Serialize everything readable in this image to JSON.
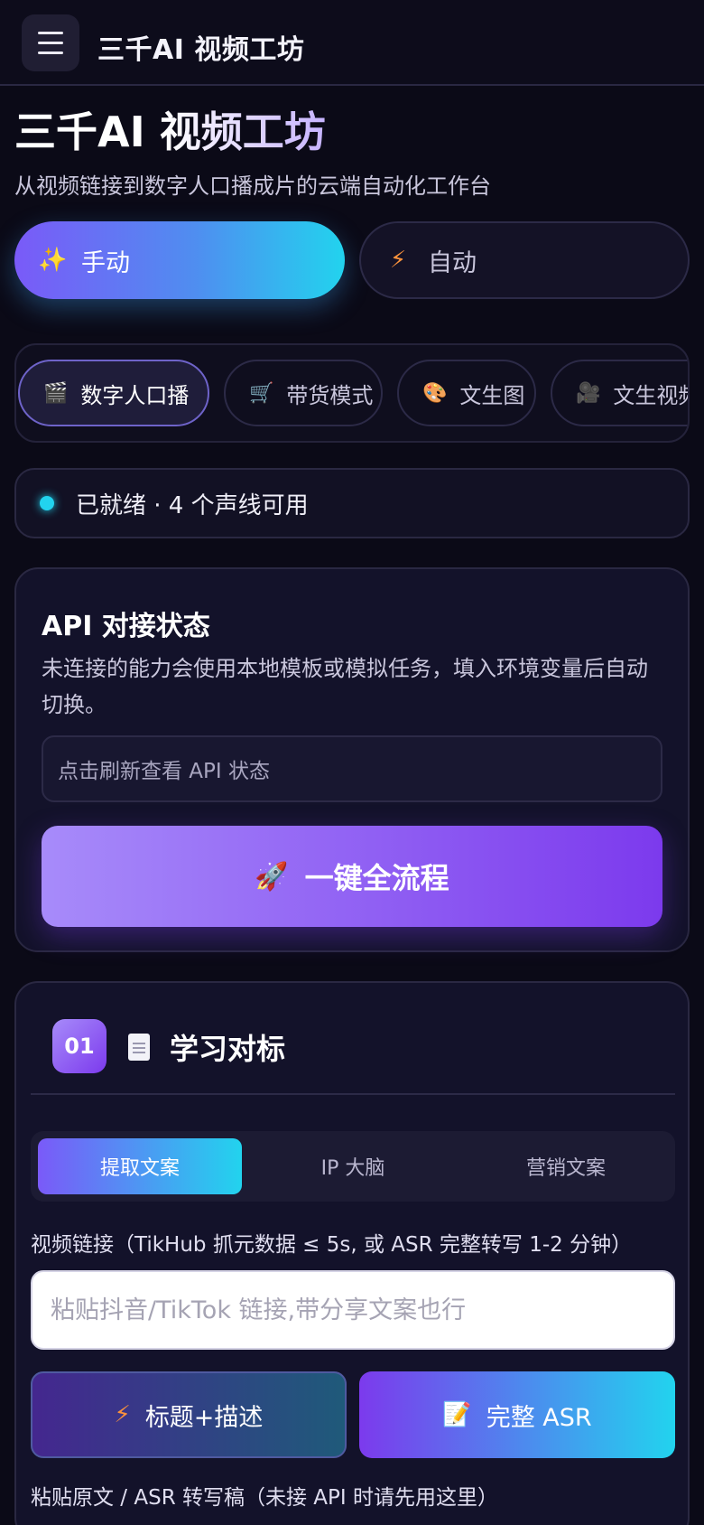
{
  "header": {
    "app_title": "三千AI 视频工坊"
  },
  "hero": {
    "title": "三千AI 视频工坊",
    "subtitle": "从视频链接到数字人口播成片的云端自动化工作台"
  },
  "modes": [
    {
      "label": "手动",
      "icon": "✨",
      "active": true
    },
    {
      "label": "自动",
      "icon": "⚡",
      "active": false
    }
  ],
  "feature_tabs": [
    {
      "label": "数字人口播",
      "icon": "🎬",
      "active": true
    },
    {
      "label": "带货模式",
      "icon": "🛒",
      "active": false
    },
    {
      "label": "文生图",
      "icon": "🎨",
      "active": false
    },
    {
      "label": "文生视频",
      "icon": "🎥",
      "active": false
    }
  ],
  "status": {
    "text": "已就绪 · 4 个声线可用",
    "color": "#22d3ee"
  },
  "api_card": {
    "title": "API 对接状态",
    "description": "未连接的能力会使用本地模板或模拟任务，填入环境变量后自动切换。",
    "status_box": "点击刷新查看 API 状态",
    "run_button": "一键全流程",
    "run_icon": "🚀"
  },
  "step1": {
    "number": "01",
    "icon": "document-icon",
    "title": "学习对标",
    "tabs": [
      {
        "label": "提取文案",
        "active": true
      },
      {
        "label": "IP 大脑",
        "active": false
      },
      {
        "label": "营销文案",
        "active": false
      }
    ],
    "url_label": "视频链接（TikHub 抓元数据 ≤ 5s, 或 ASR 完整转写 1-2 分钟）",
    "url_placeholder": "粘贴抖音/TikTok 链接,带分享文案也行",
    "btn_title_desc": "标题+描述",
    "btn_title_icon": "⚡",
    "btn_asr": "完整 ASR",
    "btn_asr_icon": "📝",
    "paste_label": "粘贴原文 / ASR 转写稿（未接 API 时请先用这里）"
  },
  "colors": {
    "accent_purple": "#7c3aed",
    "accent_cyan": "#22d3ee",
    "background": "#0b0a17"
  }
}
